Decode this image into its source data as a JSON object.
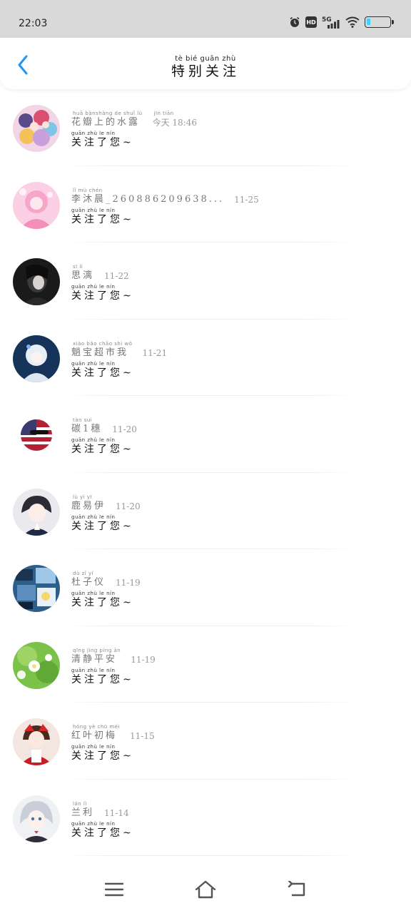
{
  "status_bar": {
    "time": "22:03",
    "network": "5G",
    "hd": "HD",
    "icons": [
      "alarm-icon",
      "hd-icon",
      "signal-icon",
      "wifi-icon",
      "battery-icon"
    ]
  },
  "header": {
    "title_pinyin": "tè  bié  guān zhù",
    "title": "特别关注",
    "back_icon": "chevron-left-icon",
    "accent_color": "#2196f3"
  },
  "follow_label": {
    "pinyin": "guān zhù   le   nín",
    "text": "关注了您~"
  },
  "items": [
    {
      "name_pinyin": "huā bànshàng de  shuǐ  lù",
      "name": "花瓣上的水露",
      "date_pinyin": "jīn  tiān",
      "date": "今天 18:46",
      "avatar": "anime-group-avatar"
    },
    {
      "name_pinyin": "lǐ   mù  chén",
      "name": "李沐晨_260886209638...",
      "date_pinyin": "",
      "date": "11-25",
      "avatar": "pink-anime-avatar"
    },
    {
      "name_pinyin": "sī   lí",
      "name": "思漓",
      "date_pinyin": "",
      "date": "11-22",
      "avatar": "dark-portrait-avatar"
    },
    {
      "name_pinyin": "xiào bǎo chāo shì  wǒ",
      "name": "魈宝超市我",
      "date_pinyin": "",
      "date": "11-21",
      "avatar": "white-hair-anime-avatar"
    },
    {
      "name_pinyin": "tàn     suì",
      "name": "碳1穗",
      "date_pinyin": "",
      "date": "11-20",
      "avatar": "flag-ball-avatar"
    },
    {
      "name_pinyin": "lù   yì   yī",
      "name": "鹿易伊",
      "date_pinyin": "",
      "date": "11-20",
      "avatar": "anime-boy-avatar"
    },
    {
      "name_pinyin": "dù   zǐ   yí",
      "name": "杜子仪",
      "date_pinyin": "",
      "date": "11-19",
      "avatar": "blue-collage-avatar"
    },
    {
      "name_pinyin": "qīng jìng píng  ān",
      "name": "清静平安",
      "date_pinyin": "",
      "date": "11-19",
      "avatar": "flower-avatar"
    },
    {
      "name_pinyin": "hóng  yè  chū  méi",
      "name": "红叶初梅",
      "date_pinyin": "",
      "date": "11-15",
      "avatar": "red-shrine-girl-avatar"
    },
    {
      "name_pinyin": "lán   lì",
      "name": "兰利",
      "date_pinyin": "",
      "date": "11-14",
      "avatar": "silver-hair-anime-avatar"
    }
  ],
  "nav_bar": {
    "menu_icon": "menu-icon",
    "home_icon": "home-icon",
    "back_icon": "back-icon"
  }
}
